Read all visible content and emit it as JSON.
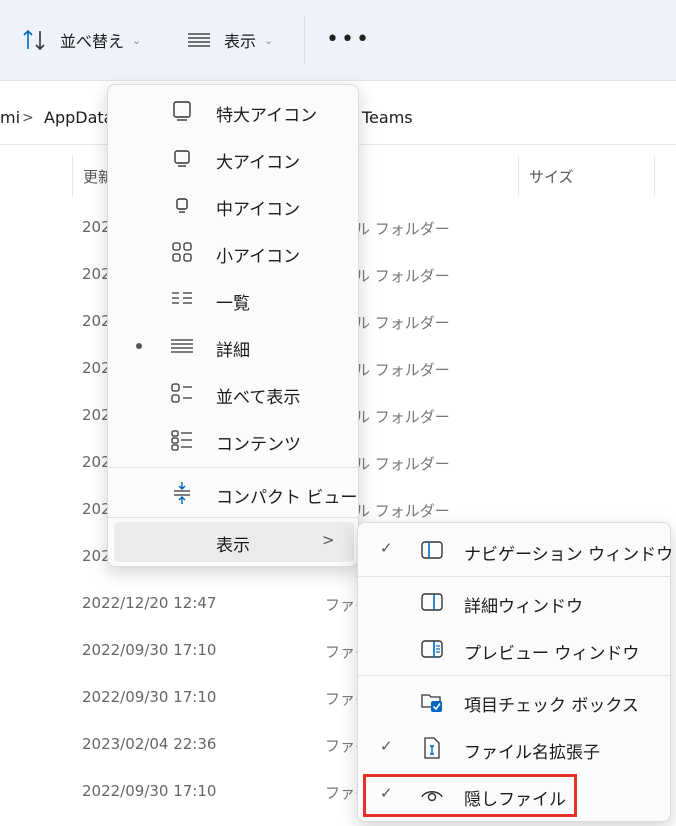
{
  "toolbar": {
    "sort_label": "並べ替え",
    "view_label": "表示",
    "more_label": "•••"
  },
  "address": {
    "crumb_partial": "mi",
    "separator": ">",
    "crumb_appdata": "AppData",
    "crumb_teams": "Teams"
  },
  "columns": {
    "modified_partial": "更新",
    "size": "サイズ"
  },
  "rows": {
    "partial_date": "202",
    "folder_type": "ル フォルダー",
    "file_type_partial": "ファイ",
    "dates": [
      "2022/12/20 12:47",
      "2022/09/30 17:10",
      "2022/09/30 17:10",
      "2023/02/04 22:36",
      "2022/09/30 17:10"
    ]
  },
  "view_menu": {
    "items": [
      {
        "label": "特大アイコン",
        "icon": "extra-large-icons-icon"
      },
      {
        "label": "大アイコン",
        "icon": "large-icons-icon"
      },
      {
        "label": "中アイコン",
        "icon": "medium-icons-icon"
      },
      {
        "label": "小アイコン",
        "icon": "small-icons-icon"
      },
      {
        "label": "一覧",
        "icon": "list-icon"
      },
      {
        "label": "詳細",
        "icon": "details-icon",
        "selected": true
      },
      {
        "label": "並べて表示",
        "icon": "tiles-icon"
      },
      {
        "label": "コンテンツ",
        "icon": "content-icon"
      }
    ],
    "compact_label": "コンパクト ビュー",
    "show_label": "表示",
    "show_arrow": ">"
  },
  "show_submenu": {
    "check_mark": "✓",
    "items": [
      {
        "label": "ナビゲーション ウィンドウ",
        "checked": true,
        "icon": "navigation-pane-icon"
      },
      {
        "label": "詳細ウィンドウ",
        "checked": false,
        "icon": "details-pane-icon"
      },
      {
        "label": "プレビュー ウィンドウ",
        "checked": false,
        "icon": "preview-pane-icon"
      },
      {
        "label": "項目チェック ボックス",
        "checked": false,
        "icon": "item-checkbox-icon"
      },
      {
        "label": "ファイル名拡張子",
        "checked": true,
        "icon": "file-extension-icon"
      },
      {
        "label": "隠しファイル",
        "checked": true,
        "icon": "hidden-files-icon"
      }
    ]
  },
  "colors": {
    "accent": "#0067c0",
    "highlight": "#e8302b"
  }
}
